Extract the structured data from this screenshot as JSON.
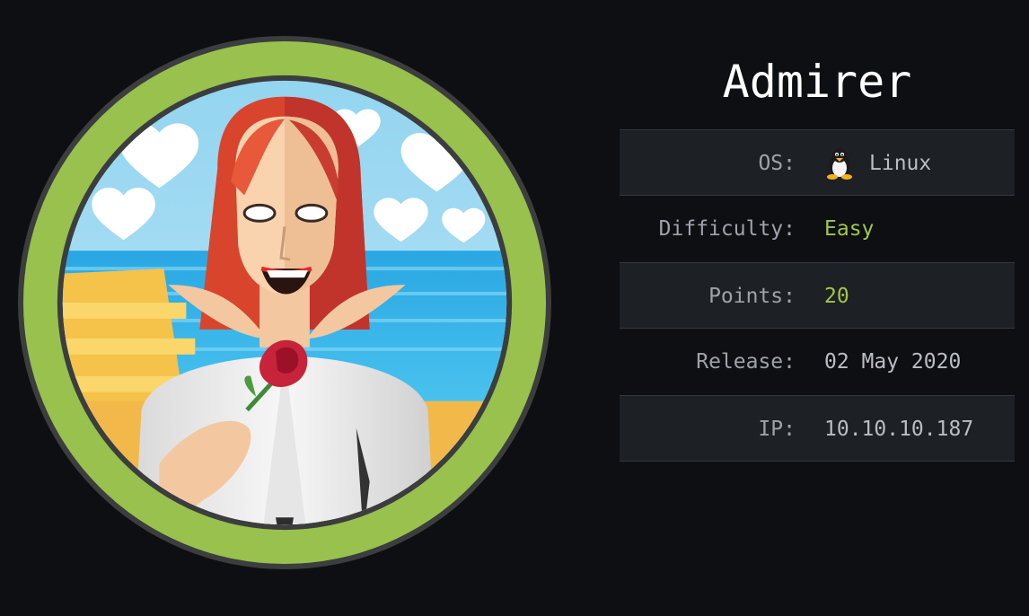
{
  "machine": {
    "name": "Admirer",
    "ring_color": "#98c14d"
  },
  "stats": {
    "os_label": "OS:",
    "os_value": "Linux",
    "os_icon": "tux-penguin-icon",
    "difficulty_label": "Difficulty:",
    "difficulty_value": "Easy",
    "difficulty_color": "#a2c648",
    "points_label": "Points:",
    "points_value": "20",
    "release_label": "Release:",
    "release_value": "02 May 2020",
    "ip_label": "IP:",
    "ip_value": "10.10.10.187"
  }
}
